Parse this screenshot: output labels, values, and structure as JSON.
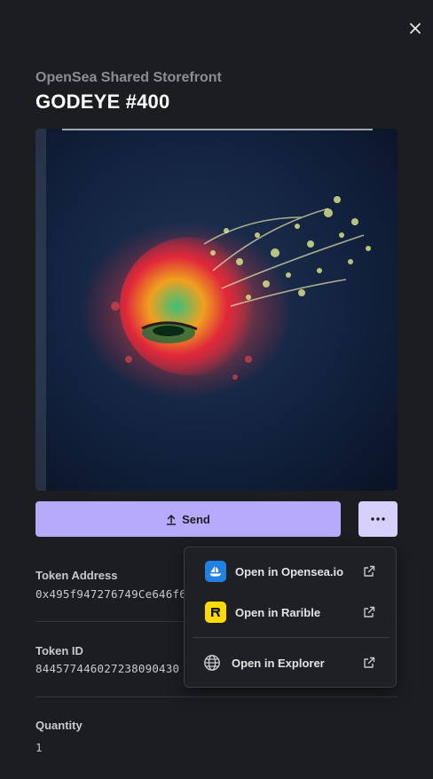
{
  "nft": {
    "collection": "OpenSea Shared Storefront",
    "title": "GODEYE #400"
  },
  "actions": {
    "send_label": "Send"
  },
  "details": {
    "token_address_label": "Token Address",
    "token_address_value": "0x495f947276749Ce646f6",
    "token_id_label": "Token ID",
    "token_id_value": "84457744602723809043​0",
    "quantity_label": "Quantity",
    "quantity_value": "1"
  },
  "menu": {
    "items": [
      {
        "label": "Open in Opensea.io",
        "icon": "opensea-icon"
      },
      {
        "label": "Open in Rarible",
        "icon": "rarible-icon"
      },
      {
        "label": "Open in Explorer",
        "icon": "globe-icon"
      }
    ]
  },
  "colors": {
    "background": "#1c1d21",
    "accent": "#b7a9fb",
    "accent_light": "#d7d0fd",
    "opensea_blue": "#2081e2",
    "rarible_yellow": "#feda03"
  }
}
